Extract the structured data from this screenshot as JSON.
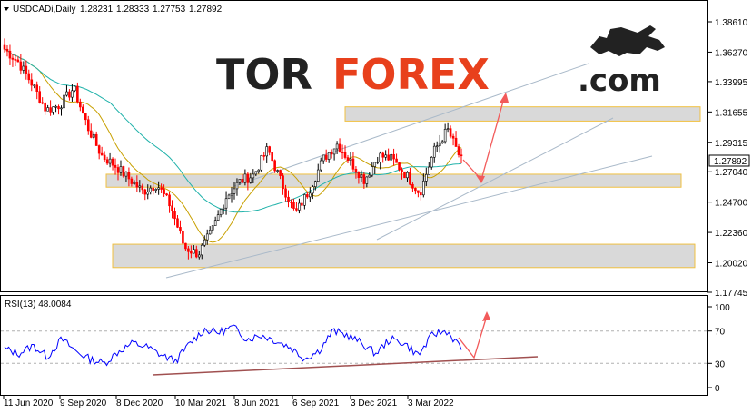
{
  "main_chart": {
    "symbol": "USDCADi,Daily",
    "ohlc": [
      "1.28231",
      "1.28333",
      "1.27753",
      "1.27892"
    ],
    "current_price": "1.27892",
    "y_ticks": [
      "1.38610",
      "1.36270",
      "1.33995",
      "1.31655",
      "1.29315",
      "1.27040",
      "1.24700",
      "1.22360",
      "1.20020",
      "1.17745"
    ],
    "x_labels": [
      "11 Jun 2020",
      "9 Sep 2020",
      "8 Dec 2020",
      "10 Mar 2021",
      "8 Jun 2021",
      "6 Sep 2021",
      "3 Dec 2021",
      "3 Mar 2022"
    ],
    "colors": {
      "up_candle": "#000000",
      "down_candle": "#ff0000",
      "ma_fast": "#c8a000",
      "ma_slow": "#20b2aa",
      "zone_fill": "#d9d9d9",
      "zone_border": "#f0c040",
      "channel": "#a9b9c9",
      "arrow": "#f25a5a"
    }
  },
  "rsi_panel": {
    "label": "RSI(13) 48.0084",
    "y_ticks": [
      "100",
      "70",
      "30",
      "0"
    ],
    "color": "#0000ff",
    "trendline_color": "#a05050"
  },
  "logo": {
    "part1": "TOR",
    "part2": "FOREX",
    "suffix": ".com",
    "icon": "bull-icon"
  },
  "chart_data": [
    {
      "type": "candlestick",
      "title": "USDCADi,Daily",
      "x": [
        "11 Jun 2020",
        "9 Sep 2020",
        "8 Dec 2020",
        "10 Mar 2021",
        "8 Jun 2021",
        "6 Sep 2021",
        "3 Dec 2021",
        "3 Mar 2022"
      ],
      "close_path": [
        1.365,
        1.355,
        1.338,
        1.318,
        1.322,
        1.335,
        1.305,
        1.283,
        1.275,
        1.265,
        1.255,
        1.261,
        1.244,
        1.212,
        1.207,
        1.225,
        1.251,
        1.263,
        1.268,
        1.288,
        1.262,
        1.238,
        1.256,
        1.28,
        1.292,
        1.278,
        1.264,
        1.283,
        1.28,
        1.268,
        1.254,
        1.286,
        1.303,
        1.279
      ],
      "ylim": [
        1.17745,
        1.3861
      ],
      "zones": [
        [
          1.3095,
          1.3205
        ],
        [
          1.2585,
          1.2685
        ],
        [
          1.1965,
          1.2145
        ]
      ]
    },
    {
      "type": "line",
      "title": "RSI(13) 48.0084",
      "values": [
        48,
        42,
        52,
        38,
        60,
        45,
        35,
        30,
        45,
        55,
        50,
        40,
        33,
        55,
        72,
        68,
        75,
        60,
        65,
        58,
        50,
        36,
        45,
        70,
        65,
        55,
        42,
        60,
        55,
        40,
        66,
        70,
        48
      ],
      "ylim": [
        0,
        100
      ],
      "levels": [
        70,
        30
      ]
    }
  ]
}
